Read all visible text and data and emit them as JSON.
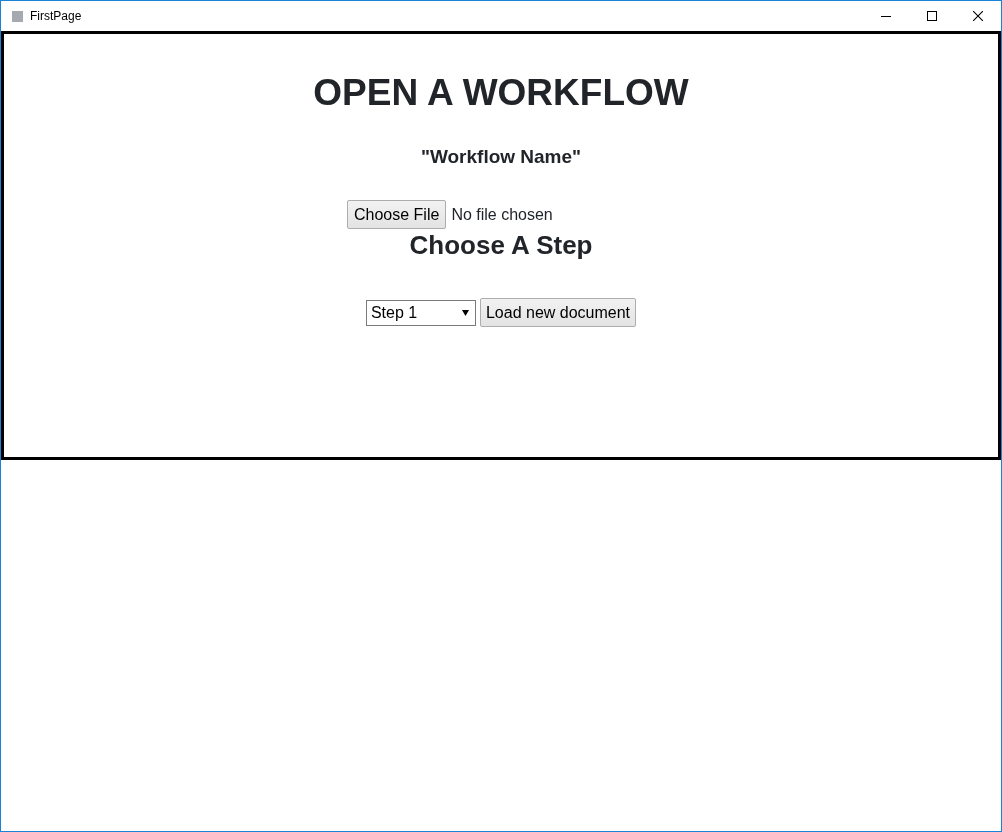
{
  "window": {
    "title": "FirstPage"
  },
  "page": {
    "heading": "OPEN A WORKFLOW",
    "workflow_name": "\"Workflow Name\"",
    "file_input": {
      "button": "Choose File",
      "status": "No file chosen"
    },
    "step_heading": "Choose A Step",
    "step_select": {
      "value": "Step 1"
    },
    "load_button": "Load new document"
  }
}
